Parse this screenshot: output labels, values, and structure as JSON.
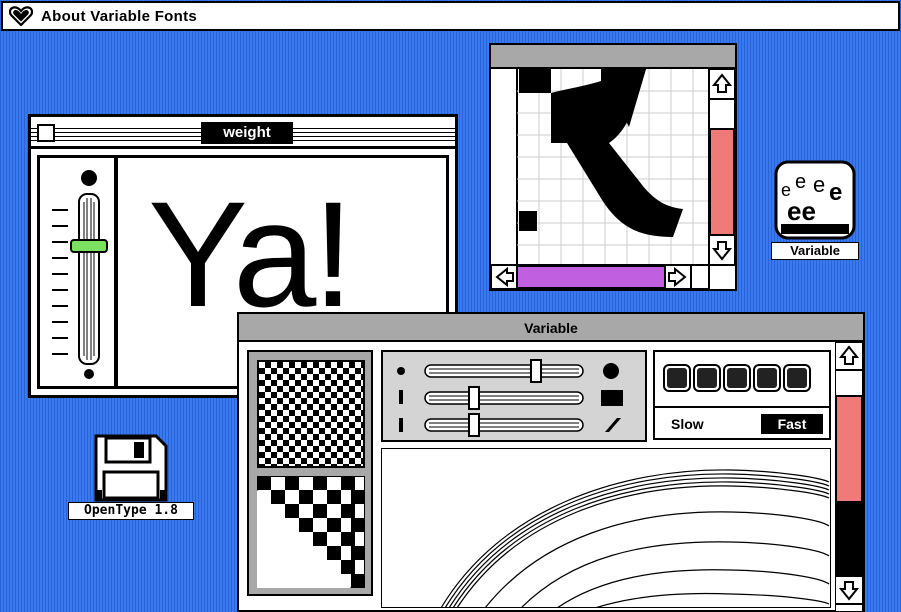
{
  "menubar": {
    "title": "About Variable Fonts",
    "icon": "heart-icon"
  },
  "weight_window": {
    "title": "weight",
    "sample_text": "Ya!"
  },
  "variable_window": {
    "title": "Variable",
    "speed": {
      "slow_label": "Slow",
      "fast_label": "Fast",
      "selected": "Fast",
      "button_count": 5
    },
    "axes": [
      {
        "name": "weight",
        "value": 0.78
      },
      {
        "name": "width",
        "value": 0.28
      },
      {
        "name": "slant",
        "value": 0.28
      }
    ]
  },
  "desktop_icons": [
    {
      "label": "Variable",
      "icon": "variable-font-icon"
    },
    {
      "label": "OpenType 1.8",
      "icon": "floppy-disk-icon"
    }
  ],
  "colors": {
    "desktop": "#2f6ee8",
    "scroll_thumb_red": "#f07a78",
    "scroll_thumb_purple": "#c060e0",
    "slider_green": "#7ce060",
    "titlebar_gray": "#a8a8a8"
  }
}
